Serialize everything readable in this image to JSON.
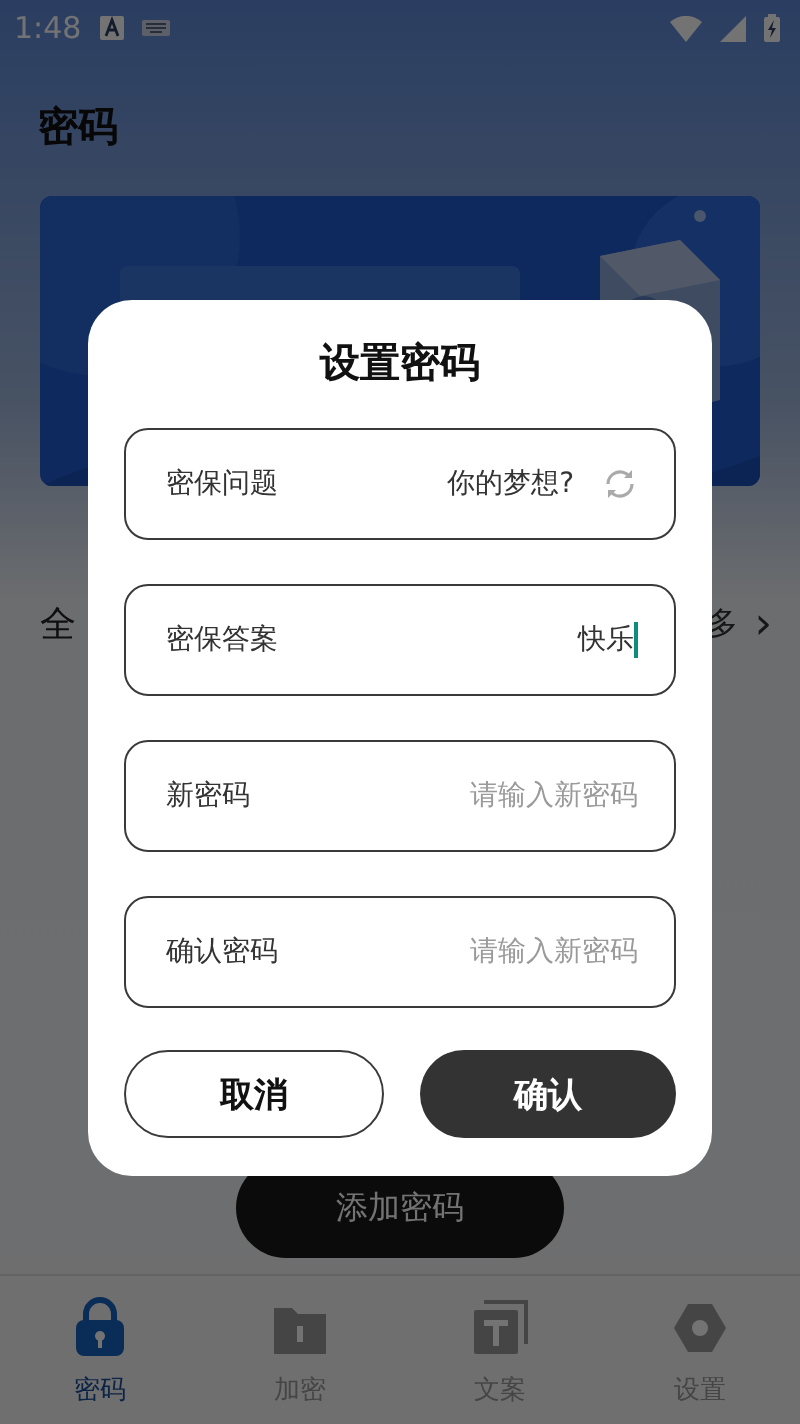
{
  "status_bar": {
    "time": "1:48"
  },
  "page": {
    "title": "密码"
  },
  "section": {
    "label": "全",
    "more": "多",
    "chevron": "›"
  },
  "add_button": {
    "label": "添加密码"
  },
  "bottom_nav": [
    {
      "label": "密码",
      "selected": true
    },
    {
      "label": "加密",
      "selected": false
    },
    {
      "label": "文案",
      "selected": false
    },
    {
      "label": "设置",
      "selected": false
    }
  ],
  "dialog": {
    "title": "设置密码",
    "fields": [
      {
        "kind": "select",
        "label": "密保问题",
        "value": "你的梦想?"
      },
      {
        "kind": "input",
        "label": "密保答案",
        "value": "快乐",
        "focused": true
      },
      {
        "kind": "input",
        "label": "新密码",
        "placeholder": "请输入新密码",
        "focused": false
      },
      {
        "kind": "input",
        "label": "确认密码",
        "placeholder": "请输入新密码",
        "focused": false
      }
    ],
    "buttons": [
      {
        "label": "取消",
        "kind": "secondary"
      },
      {
        "label": "确认",
        "kind": "primary"
      }
    ]
  }
}
